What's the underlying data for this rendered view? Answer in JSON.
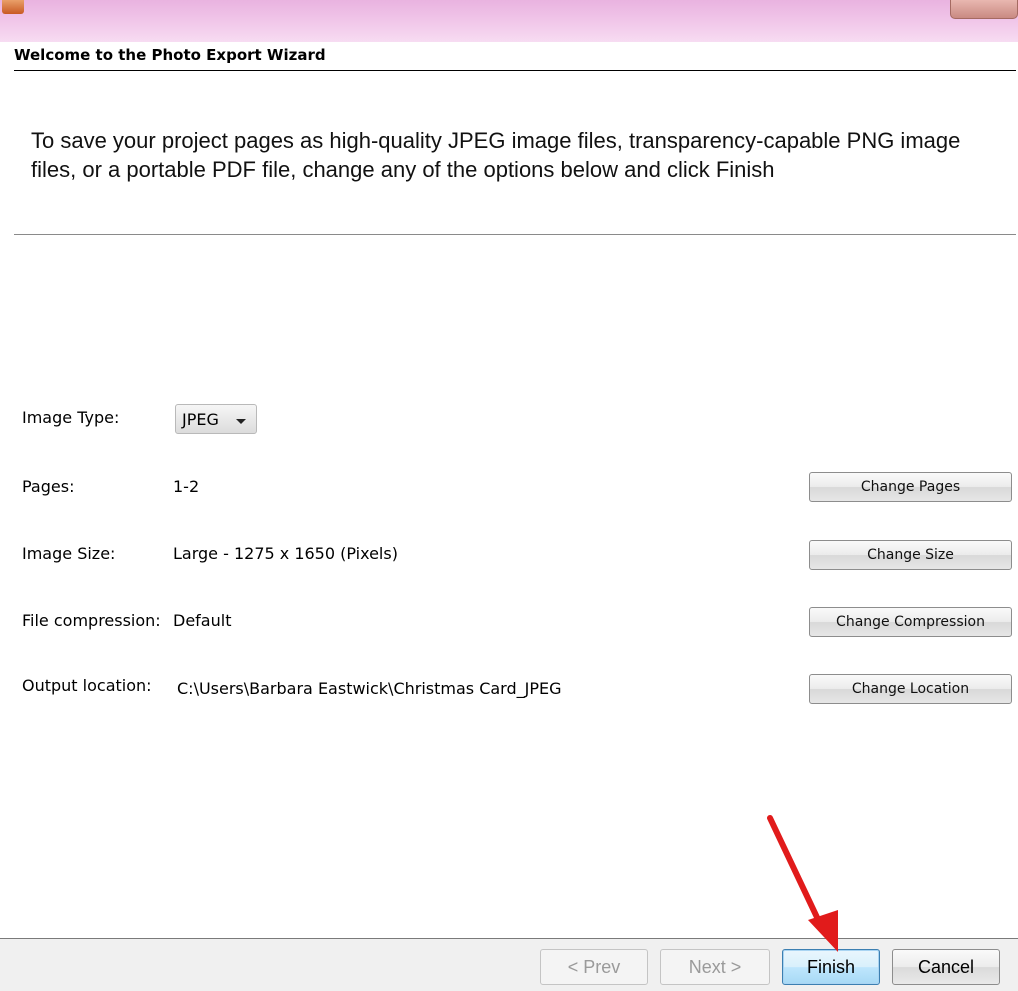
{
  "window": {
    "title": ""
  },
  "wizard": {
    "heading": "Welcome to the Photo Export Wizard",
    "intro": "To save your project pages as high-quality JPEG image files, transparency-capable PNG image files, or a portable PDF file, change any of the options below and click Finish"
  },
  "options": {
    "image_type": {
      "label": "Image Type:",
      "value": "JPEG"
    },
    "pages": {
      "label": "Pages:",
      "value": "1-2",
      "button": "Change Pages"
    },
    "image_size": {
      "label": "Image Size:",
      "value": "Large - 1275 x 1650 (Pixels)",
      "button": "Change Size"
    },
    "compression": {
      "label": "File compression:",
      "value": "Default",
      "button": "Change Compression"
    },
    "location": {
      "label": "Output location:",
      "value": "C:\\Users\\Barbara Eastwick\\Christmas Card_JPEG",
      "button": "Change Location"
    }
  },
  "footer": {
    "prev": "< Prev",
    "next": "Next >",
    "finish": "Finish",
    "cancel": "Cancel"
  },
  "colors": {
    "titlebar": "#f0c4e8",
    "annotation_arrow": "#e11b1b",
    "default_button": "#bee6fd"
  },
  "icons": [
    "app-icon",
    "close-icon",
    "chevron-down-icon",
    "red-arrow-annotation"
  ]
}
